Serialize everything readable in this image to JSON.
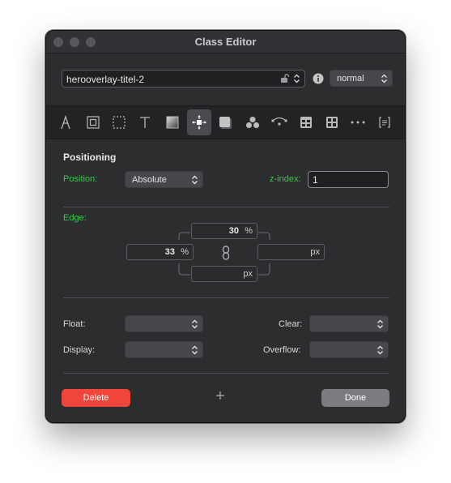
{
  "window": {
    "title": "Class Editor"
  },
  "header": {
    "class_name": "herooverlay-titel-2",
    "state_value": "normal"
  },
  "toolbar": {
    "tools": [
      {
        "icon": "typography-icon"
      },
      {
        "icon": "box-icon"
      },
      {
        "icon": "border-dashed-icon"
      },
      {
        "icon": "text-icon"
      },
      {
        "icon": "background-gradient-icon"
      },
      {
        "icon": "positioning-icon",
        "active": true
      },
      {
        "icon": "shadow-icon"
      },
      {
        "icon": "effects-icon"
      },
      {
        "icon": "transform-icon"
      },
      {
        "icon": "table-icon"
      },
      {
        "icon": "grid-icon"
      },
      {
        "icon": "more-icon"
      },
      {
        "icon": "code-icon"
      }
    ]
  },
  "positioning": {
    "section_title": "Positioning",
    "position_label": "Position:",
    "position_value": "Absolute",
    "zindex_label": "z-index:",
    "zindex_value": "1"
  },
  "edge": {
    "label": "Edge:",
    "top": {
      "value": "30",
      "unit": "%"
    },
    "left": {
      "value": "33",
      "unit": "%"
    },
    "right": {
      "value": "",
      "unit": "px"
    },
    "bottom": {
      "value": "",
      "unit": "px"
    }
  },
  "layout": {
    "float_label": "Float:",
    "float_value": "",
    "clear_label": "Clear:",
    "clear_value": "",
    "display_label": "Display:",
    "display_value": "",
    "overflow_label": "Overflow:",
    "overflow_value": ""
  },
  "footer": {
    "delete_label": "Delete",
    "add_label": "+",
    "done_label": "Done"
  },
  "colors": {
    "accent_green": "#3ac84a",
    "delete_red": "#f0453b",
    "done_gray": "#7b7c7f"
  }
}
